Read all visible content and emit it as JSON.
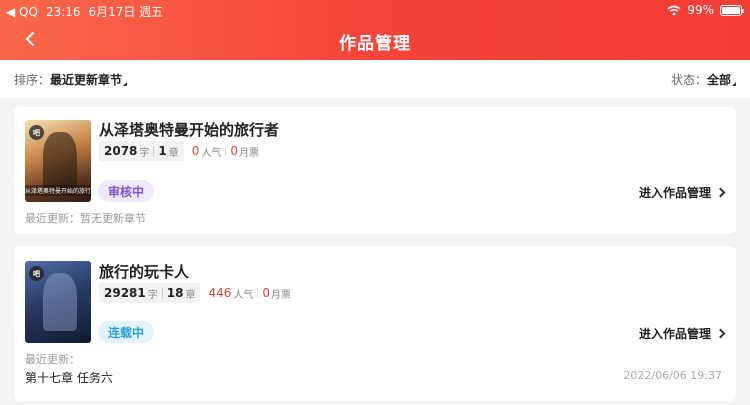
{
  "status_bar": {
    "carrier": "◀ QQ",
    "time": "23:16",
    "date": "6月17日 週五",
    "battery": "99%",
    "battery_level": 0.99
  },
  "nav": {
    "title": "作品管理"
  },
  "filters": {
    "sort_label": "排序：",
    "sort_value": "最近更新章节",
    "status_label": "状态：",
    "status_value": "全部"
  },
  "works": [
    {
      "title": "从泽塔奥特曼开始的旅行者",
      "cover_badge": "吧",
      "cover_caption": "从泽塔奥特曼开始的旅行者",
      "words": "2078",
      "words_unit": "字",
      "chapters": "1",
      "chapters_unit": "章",
      "popularity": "0",
      "popularity_unit": "人气",
      "tickets": "0",
      "tickets_unit": "月票",
      "status": "审核中",
      "manage_label": "进入作品管理",
      "latest_update": "最近更新：暂无更新章节"
    },
    {
      "title": "旅行的玩卡人",
      "cover_badge": "吧",
      "words": "29281",
      "words_unit": "字",
      "chapters": "18",
      "chapters_unit": "章",
      "popularity": "446",
      "popularity_unit": "人气",
      "tickets": "0",
      "tickets_unit": "月票",
      "status": "连载中",
      "manage_label": "进入作品管理",
      "latest_update": "最近更新：",
      "latest_chapter": "第十七章 任务六",
      "latest_date": "2022/06/06 19:37"
    }
  ],
  "colors": {
    "header_start": "#f9674a",
    "header_end": "#f23d36",
    "accent_red": "#e0453d",
    "review_tag": "#7e57c2",
    "serial_tag": "#2e9fd8"
  }
}
